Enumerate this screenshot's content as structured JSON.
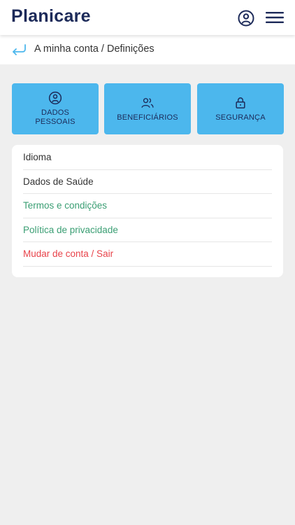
{
  "header": {
    "logo": "Planicare",
    "icons": {
      "profile": "user-circle-icon",
      "menu": "hamburger-menu-icon"
    }
  },
  "breadcrumb": {
    "back_icon": "return-arrow-icon",
    "text": "A minha conta / Definições"
  },
  "tiles": [
    {
      "label": "DADOS PESSOAIS",
      "icon": "user-circle-icon"
    },
    {
      "label": "BENEFICIÁRIOS",
      "icon": "users-icon"
    },
    {
      "label": "SEGURANÇA",
      "icon": "lock-icon"
    }
  ],
  "menu": {
    "items": [
      {
        "label": "Idioma",
        "color": "#333333"
      },
      {
        "label": "Dados de Saúde",
        "color": "#333333"
      },
      {
        "label": "Termos e condições",
        "color": "#3a9e73"
      },
      {
        "label": "Política de privacidade",
        "color": "#3a9e73"
      },
      {
        "label": "Mudar de conta / Sair",
        "color": "#e8434a"
      }
    ]
  },
  "colors": {
    "brand": "#1c2a59",
    "tile_background": "#4cb7ed",
    "page_background": "#efefef",
    "link_green": "#3a9e73",
    "danger_red": "#e8434a"
  }
}
